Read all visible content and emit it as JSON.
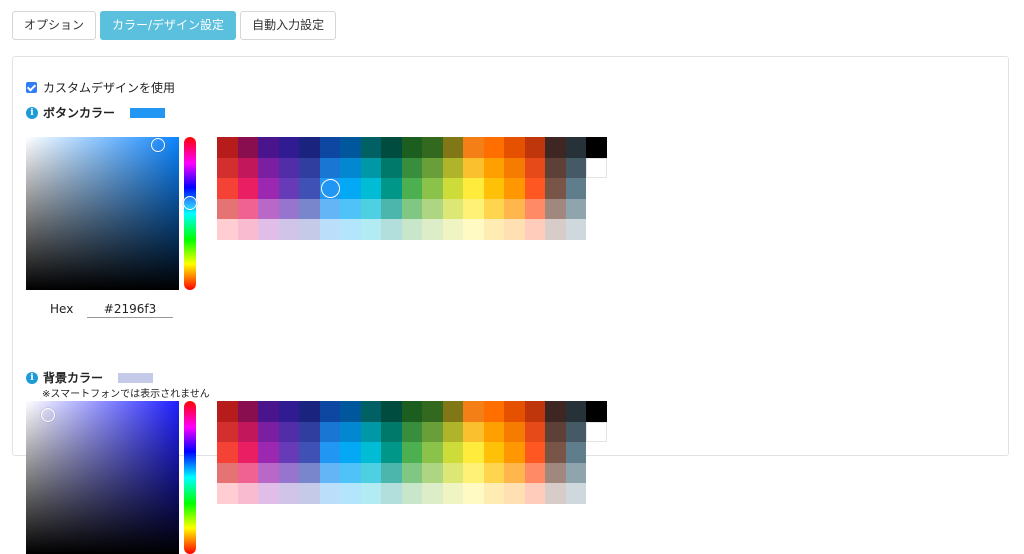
{
  "tabs": [
    {
      "label": "オプション",
      "active": false
    },
    {
      "label": "カラー/デザイン設定",
      "active": true
    },
    {
      "label": "自動入力設定",
      "active": false
    }
  ],
  "custom_design": {
    "label": "カスタムデザインを使用",
    "checked": true
  },
  "button_color": {
    "title": "ボタンカラー",
    "value": "#2196f3",
    "hue_color": "#0a84ff",
    "hex_label": "Hex",
    "hex_value": "#2196f3"
  },
  "background_color": {
    "title": "背景カラー",
    "value": "#c5cae9",
    "hue_color": "#1f1fff",
    "note": "※スマートフォンでは表示されません"
  },
  "palette": {
    "rows": [
      [
        "#b71c1c",
        "#880e4f",
        "#4a148c",
        "#311b92",
        "#1a237e",
        "#0d47a1",
        "#01579b",
        "#006064",
        "#004d40",
        "#1b5e20",
        "#33691e",
        "#827717",
        "#f57f17",
        "#ff6f00",
        "#e65100",
        "#bf360c",
        "#3e2723",
        "#263238",
        "#000000"
      ],
      [
        "#d32f2f",
        "#c2185b",
        "#7b1fa2",
        "#512da8",
        "#303f9f",
        "#1976d2",
        "#0288d1",
        "#0097a7",
        "#00796b",
        "#388e3c",
        "#689f38",
        "#afb42b",
        "#fbc02d",
        "#ffa000",
        "#f57c00",
        "#e64a19",
        "#5d4037",
        "#455a64",
        "#ffffff"
      ],
      [
        "#f44336",
        "#e91e63",
        "#9c27b0",
        "#673ab7",
        "#3f51b5",
        "#2196f3",
        "#03a9f4",
        "#00bcd4",
        "#009688",
        "#4caf50",
        "#8bc34a",
        "#cddc39",
        "#ffeb3b",
        "#ffc107",
        "#ff9800",
        "#ff5722",
        "#795548",
        "#607d8b",
        ""
      ],
      [
        "#e57373",
        "#f06292",
        "#ba68c8",
        "#9575cd",
        "#7986cb",
        "#64b5f6",
        "#4fc3f7",
        "#4dd0e1",
        "#4db6ac",
        "#81c784",
        "#aed581",
        "#dce775",
        "#fff176",
        "#ffd54f",
        "#ffb74d",
        "#ff8a65",
        "#a1887f",
        "#90a4ae",
        ""
      ],
      [
        "#ffcdd2",
        "#f8bbd0",
        "#e1bee7",
        "#d1c4e9",
        "#c5cae9",
        "#bbdefb",
        "#b3e5fc",
        "#b2ebf2",
        "#b2dfdb",
        "#c8e6c9",
        "#dcedc8",
        "#f0f4c3",
        "#fff9c4",
        "#ffecb3",
        "#ffe0b2",
        "#ffccbc",
        "#d7ccc8",
        "#cfd8dc",
        ""
      ]
    ],
    "selected": [
      2,
      5
    ]
  }
}
